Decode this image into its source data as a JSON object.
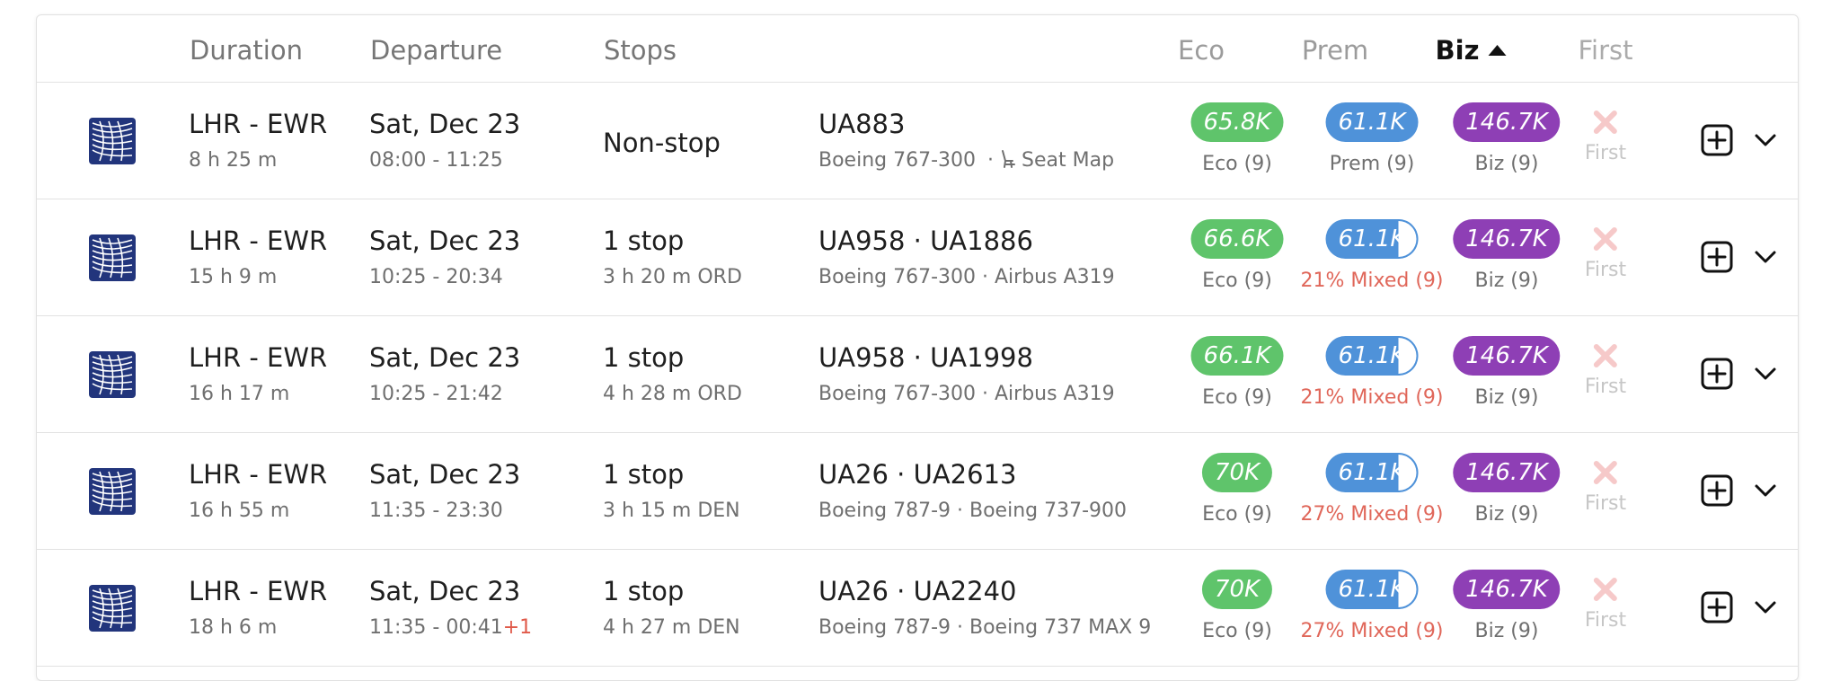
{
  "header": {
    "duration": "Duration",
    "departure": "Departure",
    "stops": "Stops",
    "eco": "Eco",
    "prem": "Prem",
    "biz": "Biz",
    "first": "First",
    "sort_icon": "caret-up-icon"
  },
  "colors": {
    "eco": "#5fc46b",
    "prem": "#4f92d9",
    "biz": "#8e3fb5",
    "mixed_text": "#e0675a",
    "first_unavailable": "#f6c9c9",
    "airline_logo": "#22357c"
  },
  "rows": [
    {
      "route": "LHR - EWR",
      "duration": "8 h 25 m",
      "date": "Sat, Dec 23",
      "time": "08:00 - 11:25",
      "plus_day": "",
      "stops": "Non-stop",
      "layover": "",
      "flights": "UA883",
      "aircraft": "Boeing 767-300",
      "aircraft_sep": "·",
      "seat_map": "Seat Map",
      "eco_price": "65.8K",
      "eco_label": "Eco (9)",
      "prem_price": "61.1K",
      "prem_label": "Prem (9)",
      "biz_price": "146.7K",
      "biz_label": "Biz (9)",
      "first_label": "First"
    },
    {
      "route": "LHR - EWR",
      "duration": "15 h 9 m",
      "date": "Sat, Dec 23",
      "time": "10:25 - 20:34",
      "plus_day": "",
      "stops": "1 stop",
      "layover": "3 h 20 m  ORD",
      "flights": "UA958  ·  UA1886",
      "aircraft": "Boeing 767-300  ·  Airbus A319",
      "eco_price": "66.6K",
      "eco_label": "Eco (9)",
      "prem_price": "61.1K",
      "prem_label": "21% Mixed (9)",
      "biz_price": "146.7K",
      "biz_label": "Biz (9)",
      "first_label": "First"
    },
    {
      "route": "LHR - EWR",
      "duration": "16 h 17 m",
      "date": "Sat, Dec 23",
      "time": "10:25 - 21:42",
      "plus_day": "",
      "stops": "1 stop",
      "layover": "4 h 28 m  ORD",
      "flights": "UA958  ·  UA1998",
      "aircraft": "Boeing 767-300  ·  Airbus A319",
      "eco_price": "66.1K",
      "eco_label": "Eco (9)",
      "prem_price": "61.1K",
      "prem_label": "21% Mixed (9)",
      "biz_price": "146.7K",
      "biz_label": "Biz (9)",
      "first_label": "First"
    },
    {
      "route": "LHR - EWR",
      "duration": "16 h 55 m",
      "date": "Sat, Dec 23",
      "time": "11:35 - 23:30",
      "plus_day": "",
      "stops": "1 stop",
      "layover": "3 h 15 m  DEN",
      "flights": "UA26  ·  UA2613",
      "aircraft": "Boeing 787-9  ·  Boeing 737-900",
      "eco_price": "70K",
      "eco_label": "Eco (9)",
      "prem_price": "61.1K",
      "prem_label": "27% Mixed (9)",
      "biz_price": "146.7K",
      "biz_label": "Biz (9)",
      "first_label": "First"
    },
    {
      "route": "LHR - EWR",
      "duration": "18 h 6 m",
      "date": "Sat, Dec 23",
      "time": "11:35 - 00:41",
      "plus_day": "+1",
      "stops": "1 stop",
      "layover": "4 h 27 m  DEN",
      "flights": "UA26  ·  UA2240",
      "aircraft": "Boeing 787-9  ·  Boeing 737 MAX 9",
      "eco_price": "70K",
      "eco_label": "Eco (9)",
      "prem_price": "61.1K",
      "prem_label": "27% Mixed (9)",
      "biz_price": "146.7K",
      "biz_label": "Biz (9)",
      "first_label": "First"
    }
  ]
}
